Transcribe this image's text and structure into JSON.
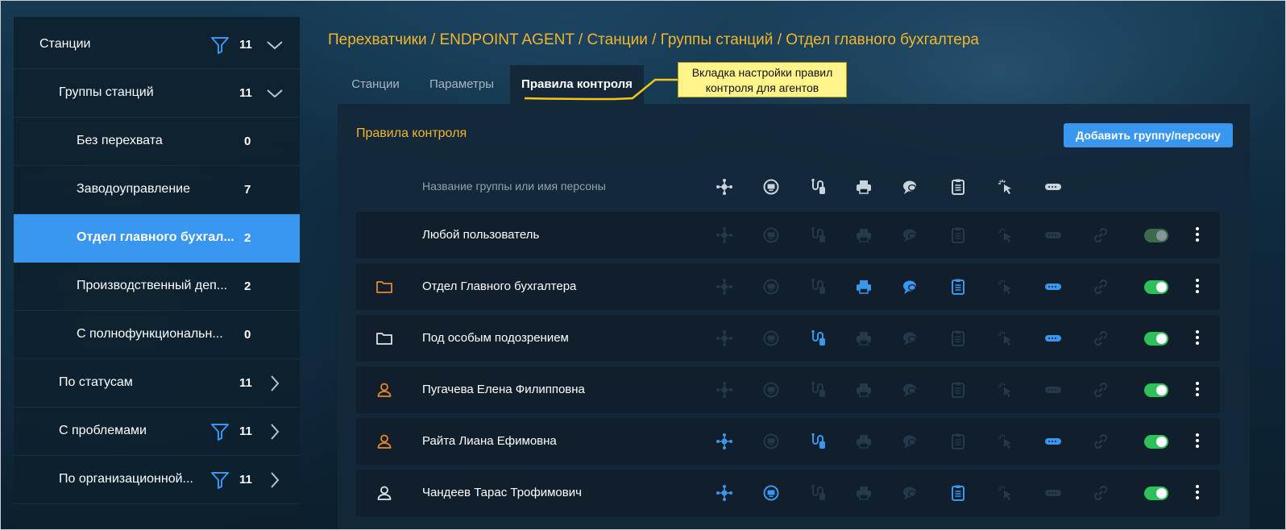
{
  "sidebar": {
    "items": [
      {
        "label": "Станции",
        "count": "11",
        "filter": true,
        "arrow": "down",
        "level": 0
      },
      {
        "label": "Группы станций",
        "count": "11",
        "filter": false,
        "arrow": "down",
        "level": 1
      },
      {
        "label": "Без перехвата",
        "count": "0",
        "filter": false,
        "arrow": "none",
        "level": 2
      },
      {
        "label": "Заводоуправление",
        "count": "7",
        "filter": false,
        "arrow": "none",
        "level": 2
      },
      {
        "label": "Отдел главного бухгал...",
        "count": "2",
        "filter": false,
        "arrow": "none",
        "level": 2,
        "active": true
      },
      {
        "label": "Производственный деп...",
        "count": "2",
        "filter": false,
        "arrow": "none",
        "level": 2
      },
      {
        "label": "С полнофункциональн...",
        "count": "0",
        "filter": false,
        "arrow": "none",
        "level": 2
      },
      {
        "label": "По статусам",
        "count": "11",
        "filter": false,
        "arrow": "right",
        "level": 1
      },
      {
        "label": "С проблемами",
        "count": "11",
        "filter": true,
        "arrow": "right",
        "level": 1
      },
      {
        "label": "По организационной...",
        "count": "11",
        "filter": true,
        "arrow": "right",
        "level": 1
      }
    ]
  },
  "breadcrumb": "Перехватчики / ENDPOINT AGENT / Станции / Группы станций / Отдел главного бухгалтера",
  "tabs": [
    {
      "label": "Станции",
      "active": false
    },
    {
      "label": "Параметры",
      "active": false
    },
    {
      "label": "Правила контроля",
      "active": true
    }
  ],
  "callout": {
    "line1": "Вкладка настройки правил",
    "line2": "контроля для агентов"
  },
  "panel": {
    "title": "Правила контроля",
    "add_button": "Добавить группу/персону",
    "column_header": "Название группы или имя персоны",
    "header_icons": [
      "network-icon",
      "screen-icon",
      "usb-icon",
      "printer-icon",
      "chat-icon",
      "clipboard-icon",
      "click-icon",
      "keylogger-icon"
    ]
  },
  "rows": [
    {
      "name": "Любой пользователь",
      "type": "none",
      "icon_color": "",
      "active_icons": [],
      "toggle_on": false
    },
    {
      "name": "Отдел Главного бухгалтера",
      "type": "folder",
      "icon_color": "#e8872c",
      "active_icons": [
        3,
        4,
        5,
        7
      ],
      "toggle_on": true
    },
    {
      "name": "Под особым подозрением",
      "type": "folder",
      "icon_color": "#dfe6ec",
      "active_icons": [
        2,
        7
      ],
      "toggle_on": true
    },
    {
      "name": "Пугачева Елена Филипповна",
      "type": "person",
      "icon_color": "#e8872c",
      "active_icons": [],
      "toggle_on": true
    },
    {
      "name": "Райта Лиана Ефимовна",
      "type": "person",
      "icon_color": "#e8872c",
      "active_icons": [
        0,
        2,
        7
      ],
      "toggle_on": true
    },
    {
      "name": "Чандеев Тарас Трофимович",
      "type": "person",
      "icon_color": "#dfe6ec",
      "active_icons": [
        0,
        1,
        5
      ],
      "toggle_on": true
    }
  ],
  "colors": {
    "accent": "#3a97ef",
    "breadcrumb": "#f5b52b",
    "toggle_on": "#2fbf5b",
    "toggle_off": "#3c6b4b",
    "icon_active": "#3a97ef",
    "icon_dim": "#24394a"
  }
}
